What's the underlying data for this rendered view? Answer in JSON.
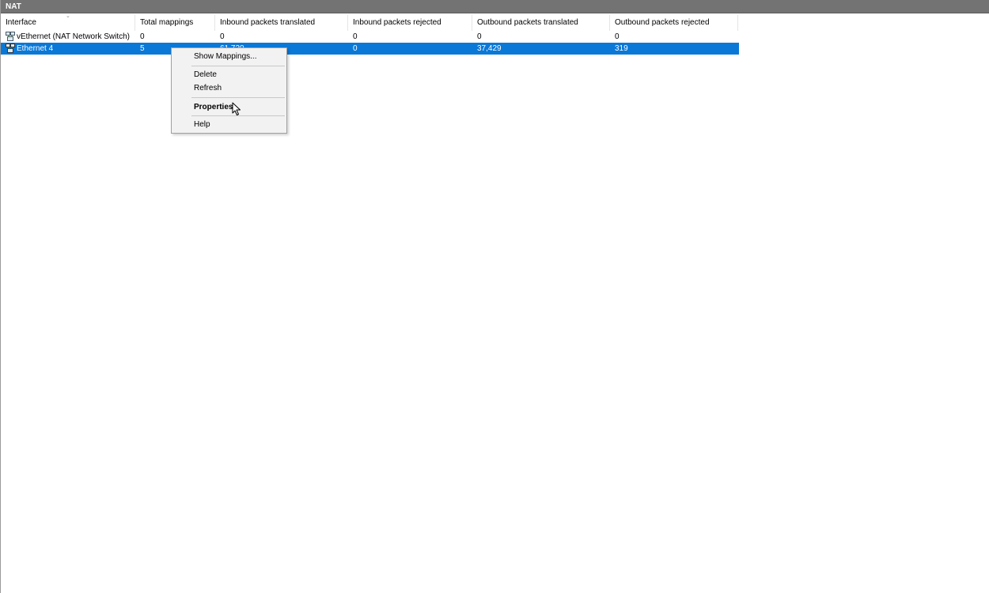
{
  "window": {
    "title": "NAT"
  },
  "columns": [
    "Interface",
    "Total mappings",
    "Inbound packets translated",
    "Inbound packets rejected",
    "Outbound packets translated",
    "Outbound packets rejected"
  ],
  "rows": [
    {
      "interface": "vEthernet (NAT Network Switch)",
      "total_mappings": "0",
      "inbound_translated": "0",
      "inbound_rejected": "0",
      "outbound_translated": "0",
      "outbound_rejected": "0",
      "selected": false,
      "icon": "network-interface-icon"
    },
    {
      "interface": "Ethernet 4",
      "total_mappings": "5",
      "inbound_translated": "61,720",
      "inbound_rejected": "0",
      "outbound_translated": "37,429",
      "outbound_rejected": "319",
      "selected": true,
      "icon": "network-interface-icon"
    }
  ],
  "context_menu": {
    "items": [
      {
        "label": "Show Mappings...",
        "bold": false
      },
      {
        "label": "Delete",
        "bold": false
      },
      {
        "label": "Refresh",
        "bold": false
      },
      {
        "label": "Properties",
        "bold": true
      },
      {
        "label": "Help",
        "bold": false
      }
    ]
  },
  "colors": {
    "title_bar": "#737373",
    "selection": "#0a78d7",
    "menu_background": "#f2f2f2"
  },
  "icons": {
    "row_icon": "network-interface-icon",
    "sort_indicator": "sort-descending-icon",
    "cursor": "mouse-pointer-icon"
  }
}
